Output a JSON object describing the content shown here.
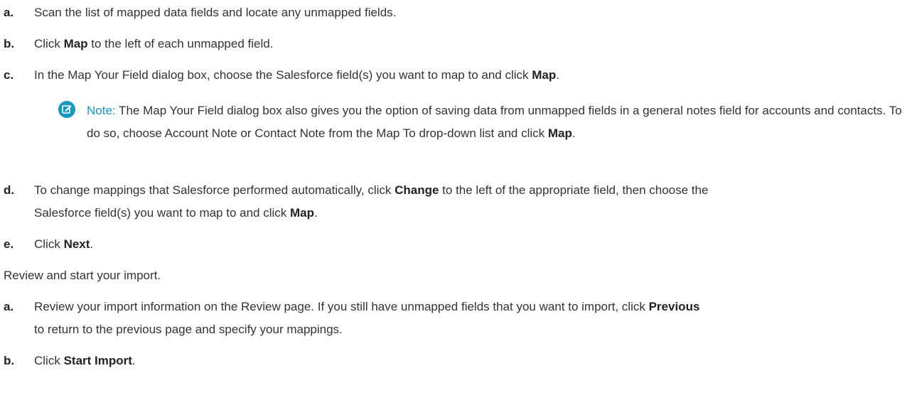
{
  "steps_a": [
    {
      "letter": "a.",
      "text_pre": "Scan the list of mapped data fields and locate any unmapped fields.",
      "bold": "",
      "text_post": ""
    },
    {
      "letter": "b.",
      "text_pre": "Click ",
      "bold": "Map",
      "text_post": " to the left of each unmapped field."
    },
    {
      "letter": "c.",
      "text_pre": "In the Map Your Field dialog box, choose the Salesforce field(s) you want to map to and click ",
      "bold": "Map",
      "text_post": "."
    }
  ],
  "note": {
    "icon": "edit-note-icon",
    "icon_color": "#1798c1",
    "label": "Note:",
    "text": " The Map Your Field dialog box also gives you the option of saving data from unmapped fields in a general notes field for accounts and contacts. To do so, choose Account Note or Contact Note from the Map To drop-down list and click ",
    "bold": "Map",
    "post": "."
  },
  "step_d": {
    "letter": "d.",
    "pre": "To change mappings that Salesforce performed automatically, click ",
    "bold1": "Change",
    "mid": " to the left of the appropriate field, then choose the",
    "line2_pre": "Salesforce field(s) you want to map to and click ",
    "bold2": "Map",
    "post": "."
  },
  "step_e": {
    "letter": "e.",
    "pre": "Click ",
    "bold": "Next",
    "post": "."
  },
  "intro": "Review and start your import.",
  "steps_b": {
    "a": {
      "letter": "a.",
      "pre": "Review your import information on the Review page. If you still have unmapped fields that you want to import, click ",
      "bold": "Previous",
      "line2": "to return to the previous page and specify your mappings."
    },
    "b": {
      "letter": "b.",
      "pre": "Click ",
      "bold": "Start Import",
      "post": "."
    }
  }
}
